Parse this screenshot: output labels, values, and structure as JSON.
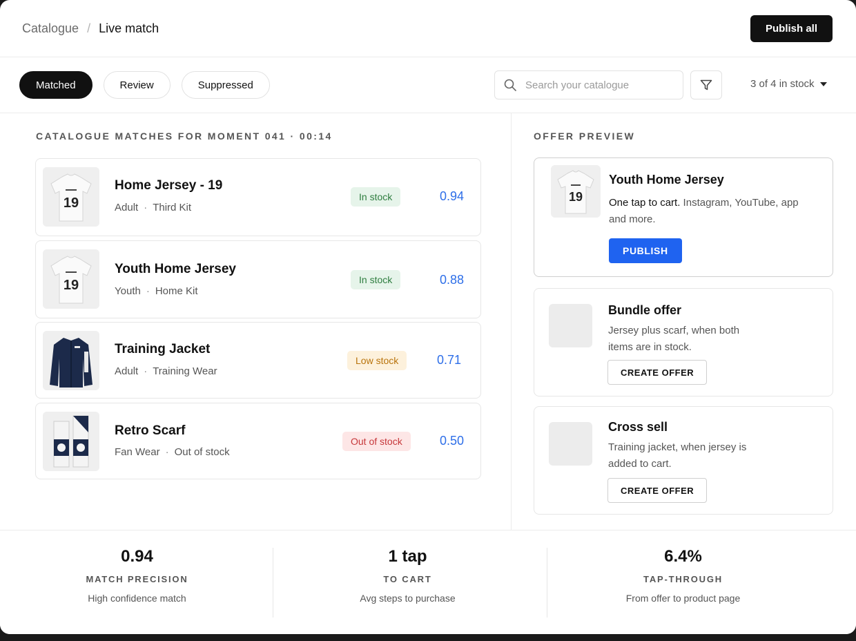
{
  "header": {
    "breadcrumb_root": "Catalogue",
    "breadcrumb_sep": "/",
    "breadcrumb_current": "Live match",
    "publish_all_label": "Publish all"
  },
  "toolbar": {
    "tabs": [
      {
        "label": "Matched",
        "active": true
      },
      {
        "label": "Review",
        "active": false
      },
      {
        "label": "Suppressed",
        "active": false
      }
    ],
    "search_placeholder": "Search your catalogue",
    "stock_filter": "3 of 4 in stock"
  },
  "matches": {
    "title": "CATALOGUE MATCHES FOR MOMENT 041 · 00:14",
    "items": [
      {
        "name": "Home Jersey - 19",
        "meta1": "Adult",
        "meta2": "Third Kit",
        "status": "In stock",
        "score": "0.94",
        "thumb": "jersey-19"
      },
      {
        "name": "Youth Home Jersey",
        "meta1": "Youth",
        "meta2": "Home Kit",
        "status": "In stock",
        "score": "0.88",
        "thumb": "jersey-19"
      },
      {
        "name": "Training Jacket",
        "meta1": "Adult",
        "meta2": "Training Wear",
        "status": "Low stock",
        "score": "0.71",
        "thumb": "jacket"
      },
      {
        "name": "Retro Scarf",
        "meta1": "Fan Wear",
        "meta2": "Out of stock",
        "status": "Out of stock",
        "score": "0.50",
        "thumb": "scarf"
      }
    ]
  },
  "offer": {
    "title": "OFFER PREVIEW",
    "main": {
      "name": "Youth Home Jersey",
      "desc_bold": "One tap to cart.",
      "desc_rest": " Instagram, YouTube, app and more.",
      "jersey_number": "19",
      "button": "PUBLISH"
    },
    "cards": [
      {
        "title": "Bundle offer",
        "desc": "Jersey plus scarf, when both items are in stock.",
        "button": "CREATE OFFER"
      },
      {
        "title": "Cross sell",
        "desc": "Training jacket, when jersey is added to cart.",
        "button": "CREATE OFFER"
      }
    ]
  },
  "stats": [
    {
      "value": "0.94",
      "label": "MATCH PRECISION",
      "sub": "High confidence match"
    },
    {
      "value": "1 tap",
      "label": "TO CART",
      "sub": "Avg steps to purchase"
    },
    {
      "value": "6.4%",
      "label": "TAP-THROUGH",
      "sub": "From offer to product page"
    }
  ],
  "colors": {
    "accent": "#1f63f0",
    "score": "#2d6ee8",
    "in_stock_bg": "#e6f4ea",
    "in_stock_text": "#2e7d3f",
    "low_stock_bg": "#fdf1dc",
    "low_stock_text": "#b8730b",
    "out_stock_bg": "#fde6e6",
    "out_stock_text": "#c6373a"
  }
}
